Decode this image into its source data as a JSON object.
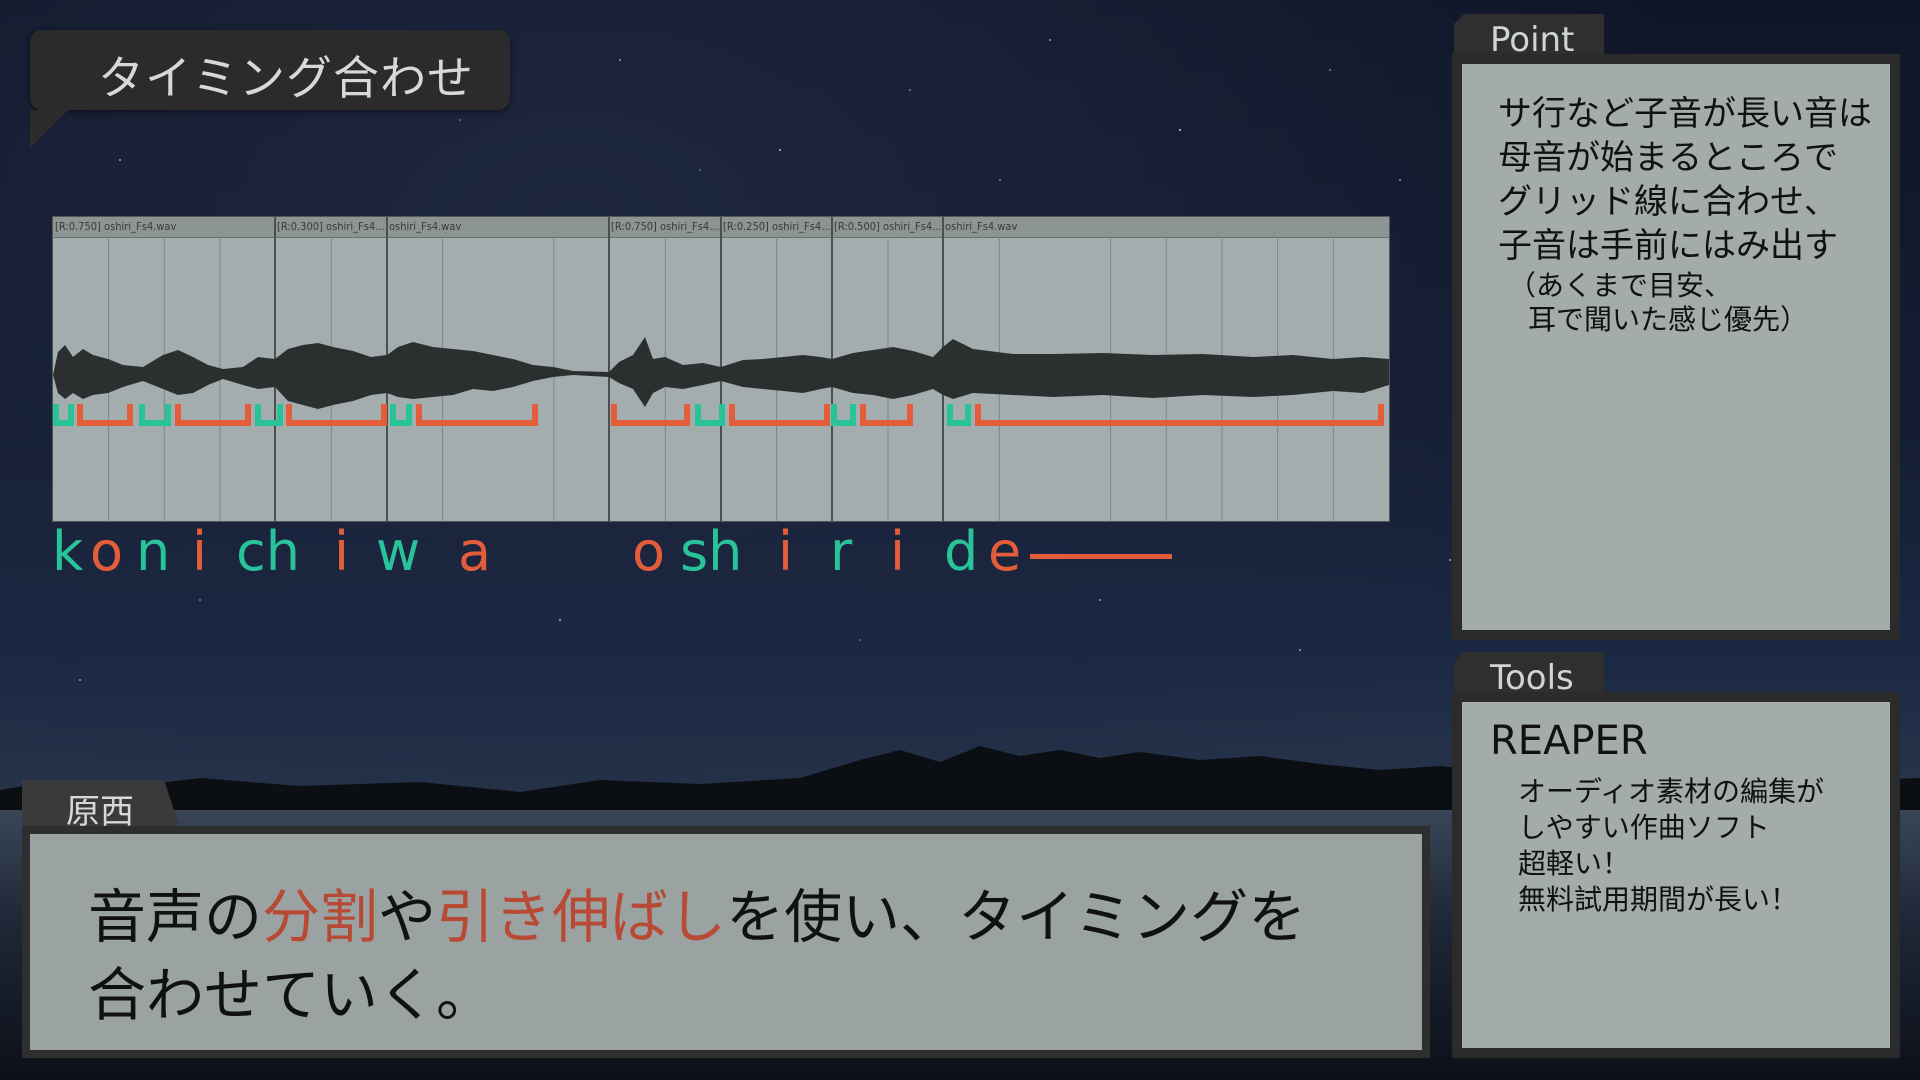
{
  "title": "タイミング合わせ",
  "waveform": {
    "clip_labels": [
      "[R:0.750] oshiri_Fs4.wav",
      "[R:0.300] oshiri_Fs4....",
      "oshiri_Fs4.wav",
      "[R:0.750] oshiri_Fs4....",
      "[R:0.250] oshiri_Fs4....",
      "[R:0.500] oshiri_Fs4....",
      "oshiri_Fs4.wav"
    ]
  },
  "phonemes": [
    "k",
    "o",
    "n",
    "i",
    "ch",
    "i",
    "w",
    "a",
    "o",
    "sh",
    "i",
    "r",
    "i",
    "d",
    "e"
  ],
  "colors": {
    "consonant": "#29c39a",
    "vowel": "#e45d3b",
    "highlight": "#b84a35"
  },
  "point": {
    "tab": "Point",
    "line1": "サ行など子音が長い音は",
    "line2_hl": "母音が始まるところ",
    "line2_rest": "で",
    "line3": "グリッド線に合わせ、",
    "line4": "子音は手前にはみ出す",
    "note1": "（あくまで目安、",
    "note2": "耳で聞いた感じ優先）"
  },
  "tools": {
    "tab": "Tools",
    "name": "REAPER",
    "items": [
      "オーディオ素材の編集が",
      "しやすい作曲ソフト",
      "超軽い！",
      "無料試用期間が長い！"
    ]
  },
  "caption": {
    "speaker": "原西",
    "l1_a": "音声の",
    "l1_b": "分割",
    "l1_c": "や",
    "l1_d": "引き伸ばし",
    "l1_e": "を使い、タイミングを",
    "line2": "合わせていく。"
  }
}
